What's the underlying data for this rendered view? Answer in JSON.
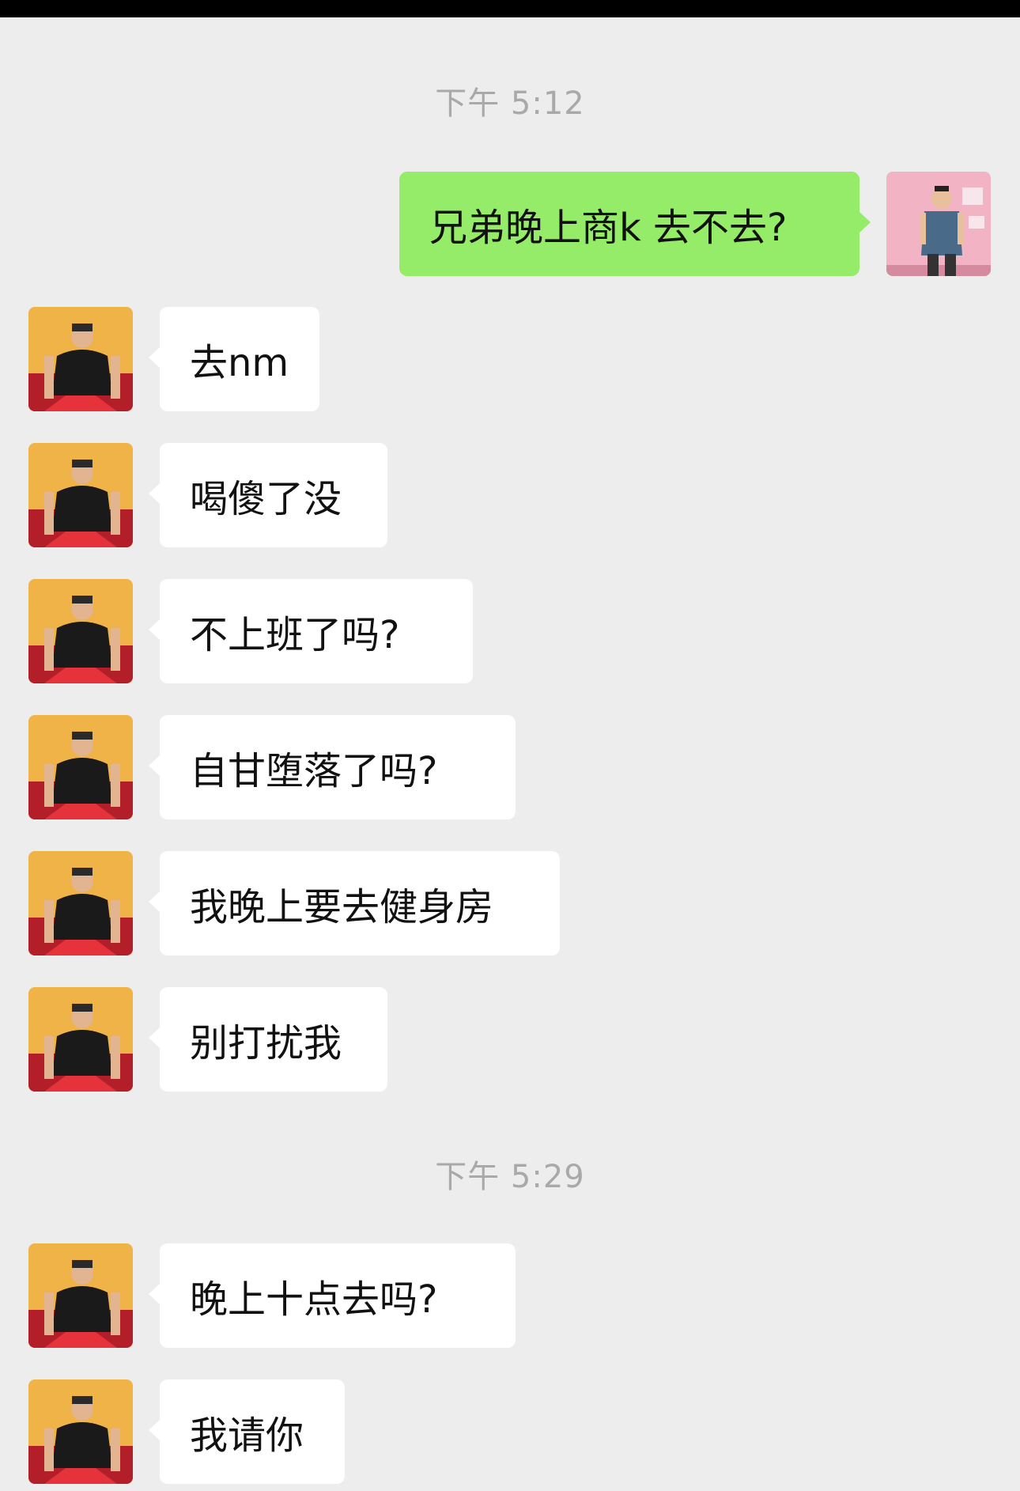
{
  "timestamps": [
    "下午 5:12",
    "下午 5:29"
  ],
  "messages": [
    {
      "side": "out",
      "text": "兄弟晚上商k 去不去?"
    },
    {
      "side": "in",
      "text": "去nm"
    },
    {
      "side": "in",
      "text": "喝傻了没"
    },
    {
      "side": "in",
      "text": "不上班了吗?"
    },
    {
      "side": "in",
      "text": "自甘堕落了吗?"
    },
    {
      "side": "in",
      "text": "我晚上要去健身房"
    },
    {
      "side": "in",
      "text": "别打扰我"
    },
    {
      "side": "in",
      "text": "晚上十点去吗?"
    },
    {
      "side": "in",
      "text": "我请你"
    }
  ],
  "colors": {
    "background": "#ededed",
    "outgoing_bubble": "#95ec69",
    "incoming_bubble": "#ffffff",
    "timestamp_text": "#a9a9a9"
  }
}
